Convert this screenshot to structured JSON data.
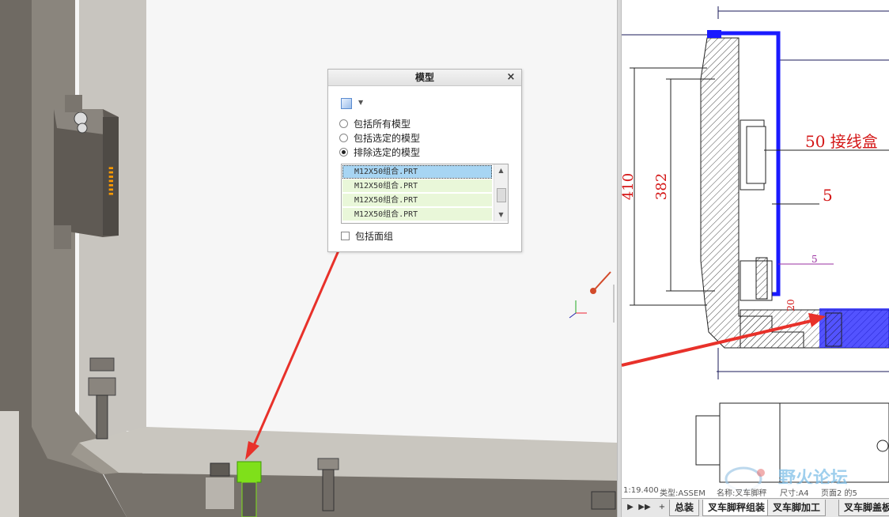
{
  "dialog": {
    "title": "模型",
    "close_glyph": "×",
    "options": [
      {
        "label": "包括所有模型",
        "selected": false
      },
      {
        "label": "包括选定的模型",
        "selected": false
      },
      {
        "label": "排除选定的模型",
        "selected": true
      }
    ],
    "list_items": [
      {
        "label": "M12X50组合.PRT",
        "selected": true
      },
      {
        "label": "M12X50组合.PRT",
        "selected": false
      },
      {
        "label": "M12X50组合.PRT",
        "selected": false
      },
      {
        "label": "M12X50组合.PRT",
        "selected": false
      }
    ],
    "include_surfaces_label": "包括面组",
    "include_surfaces_checked": false
  },
  "drawing": {
    "dim_410": "410",
    "dim_382": "382",
    "dim_50_label": "50 接线盒",
    "dim_5_large": "5",
    "dim_5_small": "5",
    "dim_20": "20"
  },
  "status_bar": {
    "scale": "1:19.400",
    "type": "类型:ASSEM",
    "name": "名称:叉车脚秤",
    "size": "尺寸:A4",
    "page": "页面2 的5"
  },
  "sheet_tabs": {
    "nav_prev": "▶",
    "nav_next": "▶▶",
    "add": "+",
    "tabs": [
      "总装",
      "叉车脚秤组装",
      "叉车脚加工",
      "叉车脚盖板"
    ],
    "active_index": 1
  },
  "watermark": {
    "text": "野火论坛"
  },
  "colors": {
    "accent_red": "#e8312a",
    "drawing_blue": "#1a1aff",
    "dim_red": "#d41818",
    "dim_purple": "#9a2fa0",
    "highlight_green": "#7fe01a",
    "list_selected": "#a7d5f3",
    "list_item": "#e9f7d9"
  }
}
